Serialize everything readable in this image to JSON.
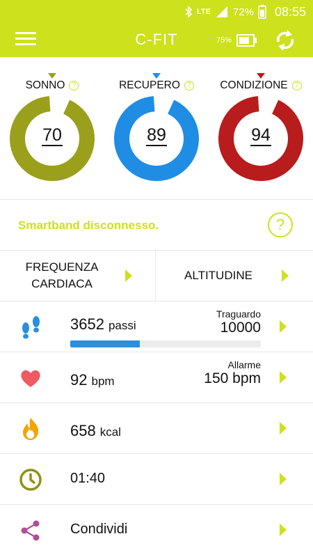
{
  "status_bar": {
    "battery_percent": "72%",
    "network": "LTE",
    "time": "08:55"
  },
  "app_bar": {
    "title": "C-FIT",
    "band_battery": "75%"
  },
  "gauges": [
    {
      "label": "SONNO",
      "value": 70,
      "value_text": "70",
      "fill_fraction": 0.92,
      "color": "#9aa01b"
    },
    {
      "label": "RECUPERO",
      "value": 89,
      "value_text": "89",
      "fill_fraction": 0.92,
      "color": "#1f8de4"
    },
    {
      "label": "CONDIZIONE",
      "value": 94,
      "value_text": "94",
      "fill_fraction": 0.92,
      "color": "#b81c1c"
    }
  ],
  "help_glyph": "?",
  "connection": {
    "message": "Smartband disconnesso."
  },
  "nav_buttons": {
    "heart_rate": "FREQUENZA\nCARDIACA",
    "altitude": "ALTITUDINE"
  },
  "steps": {
    "value": "3652",
    "unit": "passi",
    "goal_label": "Traguardo",
    "goal_value": "10000",
    "progress": 0.3652
  },
  "heart": {
    "value": "92",
    "unit": "bpm",
    "alarm_label": "Allarme",
    "alarm_value": "150 bpm"
  },
  "calories": {
    "value": "658",
    "unit": "kcal"
  },
  "time": {
    "value": "01:40"
  },
  "share": {
    "label": "Condividi"
  },
  "colors": {
    "accent": "#cde11c",
    "steps_blue": "#2b8fe0",
    "heart_red": "#ef5a63",
    "fire_orange": "#f5a300",
    "clock_olive": "#8e9216",
    "share_purple": "#b14f95"
  },
  "icons": {
    "steps": "footprints-icon",
    "heart": "heart-icon",
    "calories": "flame-icon",
    "time": "clock-icon",
    "share": "share-icon"
  }
}
